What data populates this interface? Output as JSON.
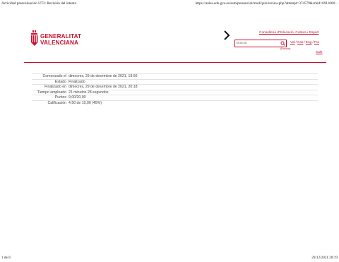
{
  "print_header": {
    "title": "Actividad preevaluación UT2: Revisión del intento",
    "url": "https://aules.edu.gva.es/semipresencial/mod/quiz/review.php?attempt=374579&cmid=691106#..."
  },
  "site_header": {
    "logo": {
      "line1": "GENERALITAT",
      "line2": "VALENCIANA"
    },
    "department_link": "Conselleria d'Educació, Cultura i Esport",
    "search": {
      "placeholder": "Buscar",
      "label": "(Buscar)"
    },
    "languages": [
      "Val",
      "Cas",
      "Eng",
      "Fra"
    ],
    "language_separator": "/",
    "logout": "Salir",
    "colors": {
      "brand": "#c8102e"
    }
  },
  "attempt_summary": {
    "rows": [
      {
        "label": "Comenzado el",
        "value": "dimecres, 29 de desembre de 2021, 19:56"
      },
      {
        "label": "Estado",
        "value": "Finalizado"
      },
      {
        "label": "Finalizado en",
        "value": "dimecres, 29 de desembre de 2021, 20:18"
      },
      {
        "label": "Tiempo empleado",
        "value": "21 minutos 28 segundos"
      },
      {
        "label": "Puntos",
        "value": "9,00/20,00"
      },
      {
        "label": "Calificación",
        "value": "4,50 de 10,00 (45%)"
      }
    ]
  },
  "print_footer": {
    "page": "1 de 8",
    "datetime": "29/12/2021 20:19"
  }
}
